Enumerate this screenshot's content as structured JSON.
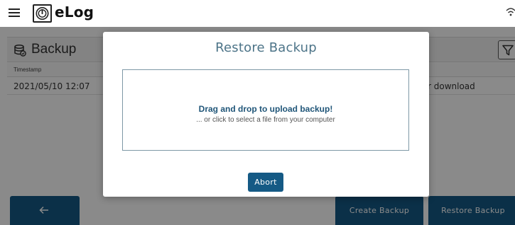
{
  "app": {
    "brand": "eLog",
    "menu_icon": "hamburger-icon",
    "logo_icon": "power-logo-icon",
    "wifi_icon": "wifi-icon"
  },
  "backup_page": {
    "title": "Backup",
    "title_icon": "database-icon",
    "filter_icon": "filter-icon",
    "table": {
      "columns": [
        "Timestamp"
      ],
      "rows": [
        {
          "timestamp": "2021/05/10 12:07",
          "action_partial": "r download"
        }
      ]
    },
    "buttons": {
      "back_icon": "arrow-left-icon",
      "create": "Create Backup",
      "restore": "Restore Backup"
    }
  },
  "dialog": {
    "title": "Restore Backup",
    "drop_main": "Drag and drop to upload backup!",
    "drop_sub": "... or click to select a file from your computer",
    "abort": "Abort"
  },
  "colors": {
    "primary": "#155a85",
    "dialog_title": "#4d7488",
    "drop_text": "#1f5578",
    "overlay": "rgba(0,0,0,0.46)"
  }
}
